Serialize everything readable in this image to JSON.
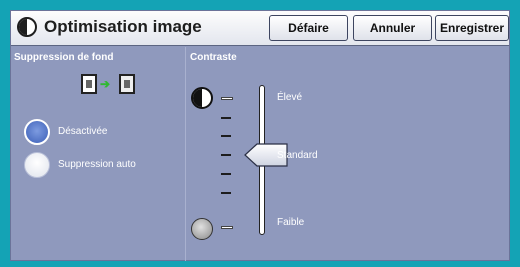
{
  "header": {
    "title": "Optimisation image",
    "buttons": {
      "undo": "Défaire",
      "cancel": "Annuler",
      "save": "Enregistrer"
    }
  },
  "background_suppression": {
    "label": "Suppression de fond",
    "options": [
      {
        "label": "Désactivée",
        "selected": true
      },
      {
        "label": "Suppression auto",
        "selected": false
      }
    ]
  },
  "contrast": {
    "label": "Contraste",
    "levels": {
      "high": "Élevé",
      "standard": "Standard",
      "low": "Faible"
    },
    "current": "Standard"
  },
  "colors": {
    "frame": "#14a3b5",
    "panel": "#8f99bd",
    "selected_radio": "#4a6cc4"
  },
  "icons": [
    "contrast-half-circle-icon",
    "document-conversion-icon",
    "arrow-right-icon",
    "slider-thumb-icon"
  ]
}
